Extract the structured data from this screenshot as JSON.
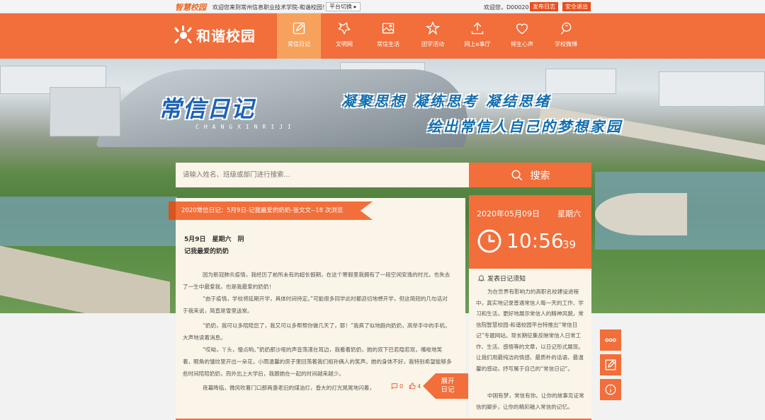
{
  "topbar": {
    "brand": "智慧校园",
    "welcome": "欢迎您来到常州信息职业技术学院-和谐校园！",
    "switch_label": "平台切换",
    "user": "欢迎您，D00020",
    "publish_btn": "发布日志",
    "logout_btn": "安全退出"
  },
  "nav": {
    "logo_text": "和谐校园",
    "items": [
      {
        "label": "常信日记",
        "icon": "edit-icon",
        "active": true
      },
      {
        "label": "文明网",
        "icon": "star-outline-icon"
      },
      {
        "label": "常信生活",
        "icon": "image-icon"
      },
      {
        "label": "团学活动",
        "icon": "star-icon"
      },
      {
        "label": "网上e事厅",
        "icon": "upload-icon"
      },
      {
        "label": "倾生心声",
        "icon": "heart-icon"
      },
      {
        "label": "学校微博",
        "icon": "weibo-icon"
      }
    ]
  },
  "banner": {
    "logo_text": "常信日记",
    "logo_sub": "CHANGXINRIJI",
    "slogan_1": "凝聚思想 凝练思考 凝结思绪",
    "slogan_2": "绘出常信人自己的梦想家园"
  },
  "search": {
    "placeholder": "请输入姓名、班级或部门进行搜索...",
    "button": "搜索"
  },
  "diary": {
    "ribbon": "2020常信日记：5月9日-记我最爱的奶奶-张文文--18 次浏览",
    "date": "5月9日　星期六　阴",
    "title": "记我最爱的奶奶",
    "paragraphs": [
      "因为新冠肺炎疫情，我经历了前所未有的超长假期，在这个寒假里我拥有了一段空闲安逸的时光，也失去了一生中最爱我，也是我最爱的奶奶！",
      "“由于疫情，学校将延期开学，具体时间待定。”可能很多同学此时都迫切地想开学，但这简短的几句话对于我来说，简直是雪里送炭。",
      "“奶奶，我可以多陪陪您了，我又可以多帮帮你做几天了，耶！”我疯了似地跑向奶奶，高举手中的手机，大声地读着消息。",
      "“哎呦，丫头，慢点哟。”奶奶那沙哑的声音荡漾在耳边，我看着奶奶，她的双下巴若隐若现，嘴唆地笑着，眼角的皱纹里开出一朵花，小雨温馨的房子里回荡着我们祖孙俩人的笑声。她的身体不好，我特别希望能够多些时间陪陪奶奶，而外出上大学后，我跟她在一起的时间越来越少。",
      "夜幕降临，微风吹着门口那两盏老旧的煤油灯，昏大的灯光晃晃地闪着，"
    ],
    "comment_count": "0",
    "like_count": "4",
    "expand_label": "展开日记"
  },
  "clock": {
    "date": "2020年05月09日",
    "weekday": "星期六",
    "time": "10:56",
    "seconds": "39"
  },
  "notice": {
    "title": "发表日记须知",
    "body": "为在世界有影响力的高职名校建设进程中，真实地记录普通常信人每一天的工作、学习和生活，更好地展示常信人的精神风貌，常信院智慧校园-和谐校园平台特推出“常信日记”专题网站。现长期征集反映常信人日常工作、生活、感悟等的文章，以日记形式展现。让我们用最纯洁的情感、最质朴的话语、最温馨的感动，抒写属于自己的“常信日记”。",
    "body2": "中国有梦，常信有你。让你的故事见证常信的脚步，让你的精彩融入常信的记忆。"
  },
  "colors": {
    "accent": "#f26e3a",
    "accent_light": "#f7a25c",
    "panel_bg": "#fbf4e8"
  }
}
